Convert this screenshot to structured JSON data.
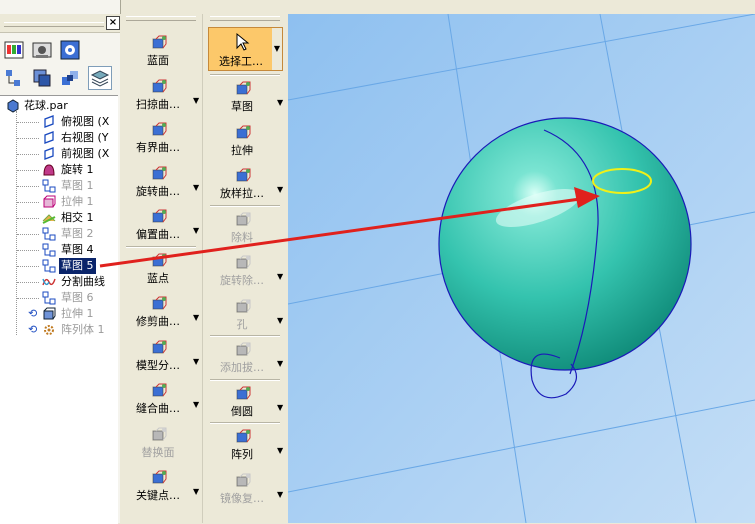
{
  "panel": {
    "close_label": "×",
    "toolbar_icons": [
      "feature-library-icon",
      "family-icon",
      "layers-settings-icon",
      "tree-view-icon",
      "parts-icon",
      "assembly-icon",
      "layers-icon"
    ]
  },
  "tree": {
    "root": "花球.par",
    "items": [
      {
        "label": "俯视图 (X",
        "state": "normal",
        "icon": "plane-icon"
      },
      {
        "label": "右视图 (Y",
        "state": "normal",
        "icon": "plane-icon"
      },
      {
        "label": "前视图 (X",
        "state": "normal",
        "icon": "plane-icon"
      },
      {
        "label": "旋转 1",
        "state": "normal",
        "icon": "revolve-icon"
      },
      {
        "label": "草图 1",
        "state": "dim",
        "icon": "sketch-icon"
      },
      {
        "label": "拉伸 1",
        "state": "dim",
        "icon": "extrude-icon"
      },
      {
        "label": "相交 1",
        "state": "normal",
        "icon": "intersect-icon"
      },
      {
        "label": "草图 2",
        "state": "dim",
        "icon": "sketch-icon"
      },
      {
        "label": "草图 4",
        "state": "normal",
        "icon": "sketch-icon"
      },
      {
        "label": "草图 5",
        "state": "selected",
        "icon": "sketch-icon"
      },
      {
        "label": "分割曲线",
        "state": "normal",
        "icon": "split-curve-icon"
      },
      {
        "label": "草图 6",
        "state": "dim",
        "icon": "sketch-icon"
      },
      {
        "label": "拉伸 1",
        "state": "dim",
        "icon": "extrude-icon"
      },
      {
        "label": "阵列体 1",
        "state": "dim",
        "icon": "pattern-icon"
      }
    ]
  },
  "surface_toolbar": [
    {
      "label": "蓝面",
      "icon": "bluesurf-icon",
      "dropdown": false,
      "enabled": true
    },
    {
      "label": "扫掠曲…",
      "icon": "sweep-icon",
      "dropdown": true,
      "enabled": true
    },
    {
      "label": "有界曲…",
      "icon": "bounded-icon",
      "dropdown": false,
      "enabled": true
    },
    {
      "label": "旋转曲…",
      "icon": "revolve-surface-icon",
      "dropdown": true,
      "enabled": true
    },
    {
      "label": "偏置曲…",
      "icon": "offset-icon",
      "dropdown": true,
      "enabled": true
    },
    {
      "label": "蓝点",
      "icon": "bluedot-icon",
      "dropdown": false,
      "enabled": true
    },
    {
      "label": "修剪曲…",
      "icon": "trim-icon",
      "dropdown": true,
      "enabled": true
    },
    {
      "label": "模型分…",
      "icon": "split-body-icon",
      "dropdown": true,
      "enabled": true
    },
    {
      "label": "缝合曲…",
      "icon": "stitch-icon",
      "dropdown": true,
      "enabled": true
    },
    {
      "label": "替换面",
      "icon": "replace-face-icon",
      "dropdown": false,
      "enabled": false
    },
    {
      "label": "关键点…",
      "icon": "keypoint-icon",
      "dropdown": true,
      "enabled": true
    }
  ],
  "feature_toolbar": {
    "select_label": "选择工…",
    "items": [
      {
        "label": "草图",
        "icon": "sketch-icon",
        "dropdown": true,
        "enabled": true
      },
      {
        "label": "拉伸",
        "icon": "extrude-icon",
        "dropdown": false,
        "enabled": true
      },
      {
        "label": "放样拉…",
        "icon": "loft-icon",
        "dropdown": true,
        "enabled": true
      },
      {
        "label": "除料",
        "icon": "cutout-icon",
        "dropdown": false,
        "enabled": false
      },
      {
        "label": "旋转除…",
        "icon": "revolve-cut-icon",
        "dropdown": true,
        "enabled": false
      },
      {
        "label": "孔",
        "icon": "hole-icon",
        "dropdown": true,
        "enabled": false
      },
      {
        "label": "添加拔…",
        "icon": "draft-icon",
        "dropdown": true,
        "enabled": false
      },
      {
        "label": "倒圆",
        "icon": "round-icon",
        "dropdown": true,
        "enabled": true
      },
      {
        "label": "阵列",
        "icon": "pattern-icon",
        "dropdown": true,
        "enabled": true
      },
      {
        "label": "镜像复…",
        "icon": "mirror-icon",
        "dropdown": true,
        "enabled": false
      }
    ]
  },
  "colors": {
    "viewport_bg": "#a9cff3",
    "sphere": "#3cc6b4",
    "arrow": "#e0211d",
    "highlight_curve": "#f0f018",
    "selection": "#0a246a"
  }
}
